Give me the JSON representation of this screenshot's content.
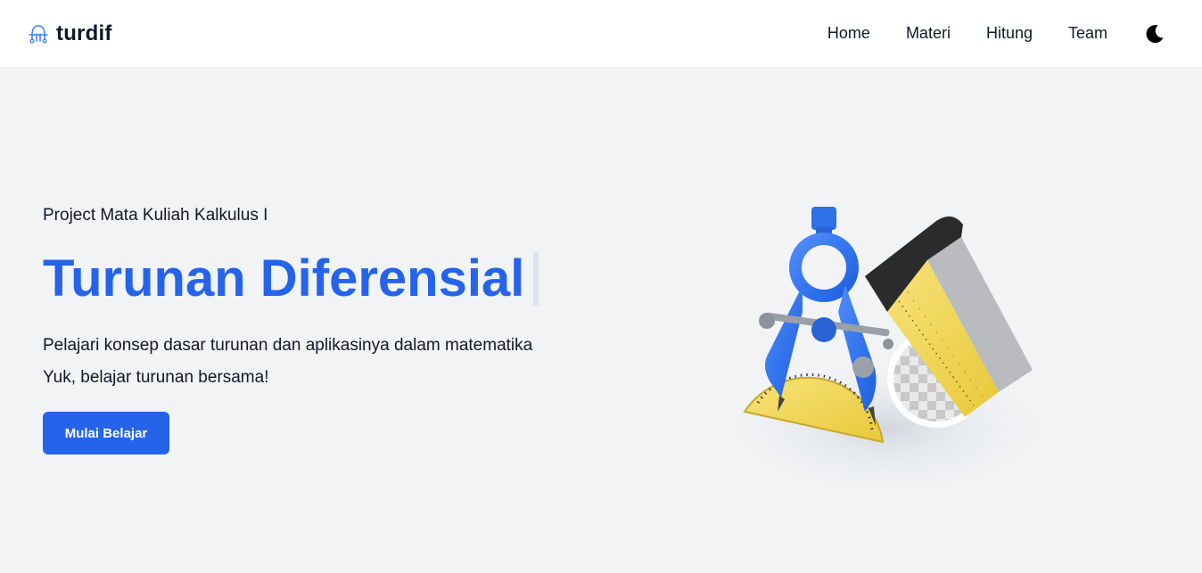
{
  "nav": {
    "brand": "turdif",
    "links": [
      {
        "label": "Home"
      },
      {
        "label": "Materi"
      },
      {
        "label": "Hitung"
      },
      {
        "label": "Team"
      }
    ],
    "theme_icon": "moon-icon",
    "brand_icon": "ghost-icon"
  },
  "hero": {
    "subtitle": "Project Mata Kuliah Kalkulus I",
    "title": "Turunan Diferensial",
    "description_lines": [
      "Pelajari konsep dasar turunan dan aplikasinya dalam matematika",
      "Yuk, belajar turunan bersama!"
    ],
    "cta_label": "Mulai Belajar",
    "illustration": "math-tools-illustration"
  },
  "colors": {
    "accent": "#2563eb",
    "background": "#f1f3f5",
    "navbar": "#ffffff"
  }
}
